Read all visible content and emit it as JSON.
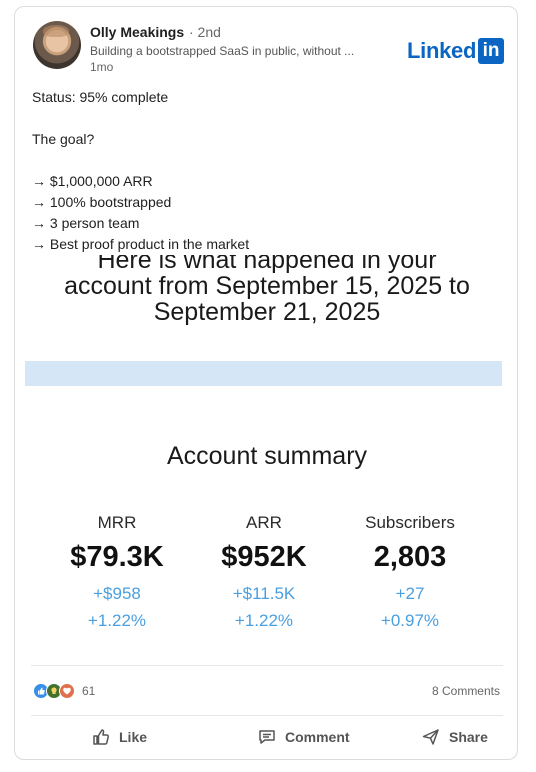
{
  "post": {
    "author": "Olly Meakings",
    "degree": "· 2nd",
    "headline": "Building a bootstrapped SaaS in public, without ...",
    "time": "1mo",
    "brand": {
      "text": "Linked",
      "box": "in",
      "color": "#0a66c2"
    },
    "lines": [
      "Status: 95% complete",
      "",
      "The goal?",
      "",
      "→ $1,000,000 ARR",
      "→ 100% bootstrapped",
      "→ 3 person team",
      "→ Best proof product in the market"
    ]
  },
  "embed": {
    "headline": "Here is what happened in your account from September 15, 2025 to September 21, 2025",
    "headline_lines": [
      "Here is what happened in your",
      "account from September 15, 2025 to",
      "September 21, 2025"
    ],
    "summary_title": "Account summary",
    "metrics": [
      {
        "label": "MRR",
        "value": "$79.3K",
        "delta": "+$958",
        "pct": "+1.22%"
      },
      {
        "label": "ARR",
        "value": "$952K",
        "delta": "+$11.5K",
        "pct": "+1.22%"
      },
      {
        "label": "Subscribers",
        "value": "2,803",
        "delta": "+27",
        "pct": "+0.97%"
      }
    ],
    "accent_color": "#4a9fe0"
  },
  "social": {
    "reaction_icons": [
      "like-icon",
      "celebrate-icon",
      "love-icon"
    ],
    "reaction_count": "61",
    "comments_count": "8 Comments"
  },
  "actions": {
    "like": "Like",
    "comment": "Comment",
    "share": "Share"
  }
}
